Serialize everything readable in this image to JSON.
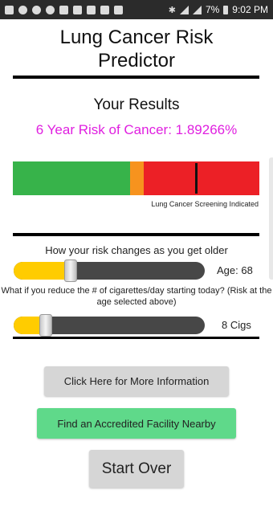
{
  "status_bar": {
    "battery": "7%",
    "time": "9:02 PM"
  },
  "app": {
    "title_line1": "Lung Cancer Risk",
    "title_line2": "Predictor"
  },
  "results": {
    "heading": "Your Results",
    "risk_text": "6 Year Risk of Cancer: 1.89266%",
    "risk_color": "#e020e0",
    "bar_colors": {
      "low": "#37b34a",
      "medium": "#f7931e",
      "high": "#ec2026"
    },
    "screening_note": "Lung Cancer Screening Indicated"
  },
  "age_slider": {
    "question": "How your risk changes as you get older",
    "value_label": "Age: 68",
    "fill_fraction": 0.3
  },
  "cig_slider": {
    "question": "What if you reduce the # of cigarettes/day starting today? (Risk at the age selected above)",
    "value_label": "8 Cigs",
    "fill_fraction": 0.17
  },
  "buttons": {
    "more_info": "Click Here for More Information",
    "find_facility": "Find an Accredited Facility Nearby",
    "start_over": "Start Over"
  }
}
